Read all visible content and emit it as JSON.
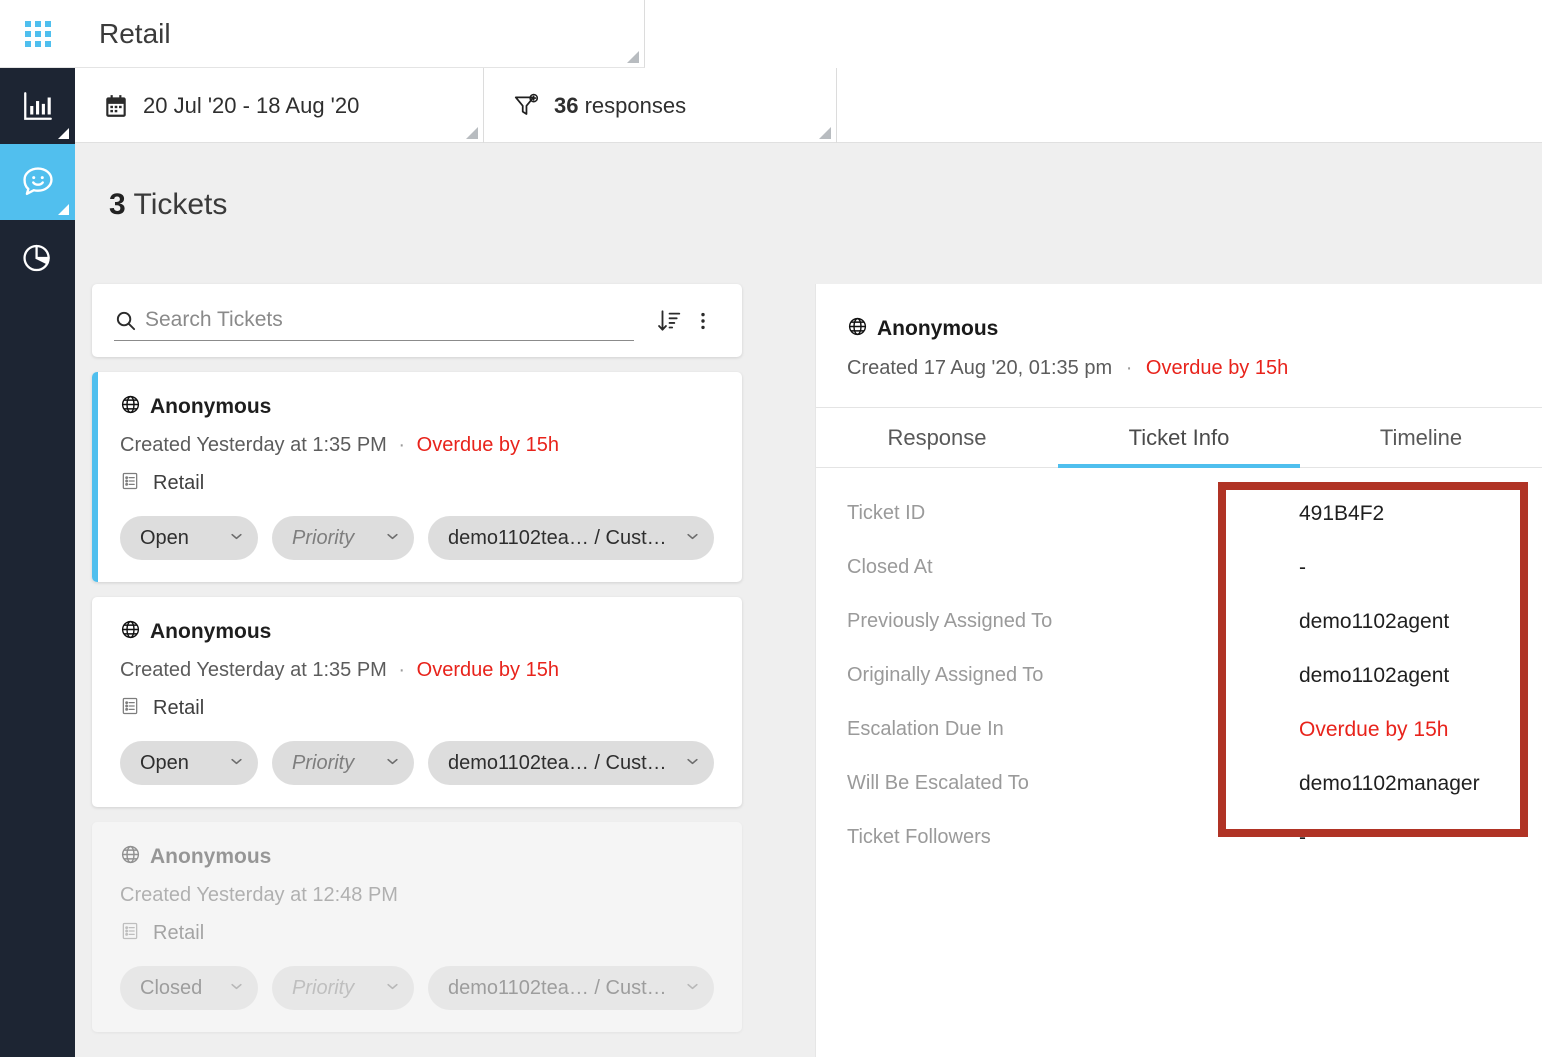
{
  "app": {
    "launcher_icon": "grid-apps-icon",
    "title": "Retail"
  },
  "sidebar": {
    "items": [
      {
        "icon": "bar-chart-icon",
        "name": "dashboard",
        "active": false
      },
      {
        "icon": "chat-smiley-icon",
        "name": "tickets",
        "active": true
      },
      {
        "icon": "pie-chart-icon",
        "name": "reports",
        "active": false
      }
    ]
  },
  "filters": {
    "date": {
      "icon": "calendar-icon",
      "label": "20 Jul '20 - 18 Aug '20"
    },
    "responses": {
      "icon": "funnel-add-icon",
      "count": "36",
      "label": "responses"
    }
  },
  "tickets_header": {
    "count": "3",
    "label": "Tickets"
  },
  "search": {
    "icon": "search-icon",
    "placeholder": "Search Tickets",
    "value": "",
    "sort_icon": "sort-descending-icon",
    "more_icon": "more-vertical-icon"
  },
  "tickets": [
    {
      "globe_icon": "globe-icon",
      "name": "Anonymous",
      "created": "Created Yesterday at 1:35 PM",
      "separator": "·",
      "overdue": "Overdue by 15h",
      "category_icon": "list-icon",
      "category": "Retail",
      "status": "Open",
      "priority": "Priority",
      "assignee": "demo1102tea…  / Cust…",
      "selected": true,
      "muted": false
    },
    {
      "globe_icon": "globe-icon",
      "name": "Anonymous",
      "created": "Created Yesterday at 1:35 PM",
      "separator": "·",
      "overdue": "Overdue by 15h",
      "category_icon": "list-icon",
      "category": "Retail",
      "status": "Open",
      "priority": "Priority",
      "assignee": "demo1102tea…  / Cust…",
      "selected": false,
      "muted": false
    },
    {
      "globe_icon": "globe-icon",
      "name": "Anonymous",
      "created": "Created Yesterday at 12:48 PM",
      "separator": "",
      "overdue": "",
      "category_icon": "list-icon",
      "category": "Retail",
      "status": "Closed",
      "priority": "Priority",
      "assignee": "demo1102tea…  / Cust…",
      "selected": false,
      "muted": true
    }
  ],
  "detail": {
    "globe_icon": "globe-icon",
    "name": "Anonymous",
    "created": "Created 17 Aug '20, 01:35 pm",
    "separator": "·",
    "overdue": "Overdue by 15h",
    "tabs": [
      {
        "label": "Response",
        "active": false
      },
      {
        "label": "Ticket Info",
        "active": true
      },
      {
        "label": "Timeline",
        "active": false
      }
    ],
    "info_rows": [
      {
        "label": "Ticket ID",
        "value": "491B4F2",
        "red": false
      },
      {
        "label": "Closed At",
        "value": "-",
        "red": false
      },
      {
        "label": "Previously Assigned To",
        "value": "demo1102agent",
        "red": false
      },
      {
        "label": "Originally Assigned To",
        "value": "demo1102agent",
        "red": false
      },
      {
        "label": "Escalation Due In",
        "value": "Overdue by 15h",
        "red": true
      },
      {
        "label": "Will Be Escalated To",
        "value": "demo1102manager",
        "red": false
      },
      {
        "label": "Ticket Followers",
        "value": "-",
        "red": false
      }
    ]
  },
  "annotation": {
    "shape": "rectangle",
    "color": "#b03325"
  },
  "colors": {
    "accent": "#4fbfee",
    "sidebar_bg": "#1d2533",
    "overdue_red": "#e8231b",
    "annotation_red": "#b03325",
    "page_bg": "#efefef",
    "pill_bg": "#dddddd"
  }
}
